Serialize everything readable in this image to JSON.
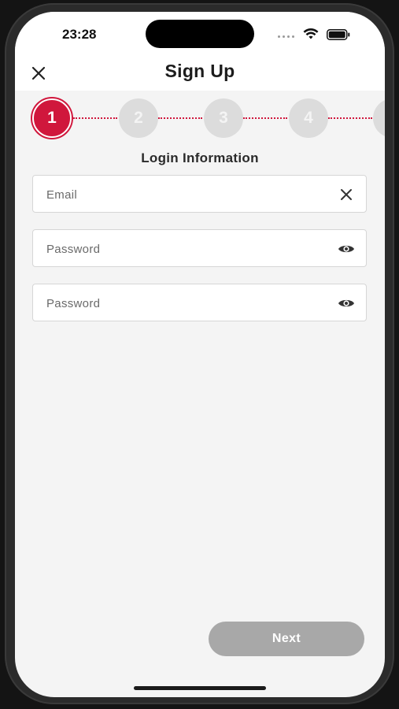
{
  "status_bar": {
    "time": "23:28"
  },
  "header": {
    "title": "Sign Up",
    "close_icon": "close-icon"
  },
  "stepper": {
    "current_step": 1,
    "steps": [
      {
        "label": "1",
        "state": "active"
      },
      {
        "label": "2",
        "state": "inactive"
      },
      {
        "label": "3",
        "state": "inactive"
      },
      {
        "label": "4",
        "state": "inactive"
      },
      {
        "label": "",
        "state": "inactive"
      }
    ]
  },
  "form": {
    "section_title": "Login Information",
    "email": {
      "placeholder": "Email",
      "value": "",
      "icon": "clear-icon"
    },
    "password": {
      "placeholder": "Password",
      "value": "",
      "icon": "eye-icon"
    },
    "confirm_password": {
      "placeholder": "Password",
      "value": "",
      "icon": "eye-icon"
    }
  },
  "footer": {
    "next_label": "Next"
  },
  "colors": {
    "accent": "#d0173c",
    "inactive_step": "#dcdcdc",
    "disabled_button": "#a8a8a8",
    "background": "#f4f4f4"
  }
}
